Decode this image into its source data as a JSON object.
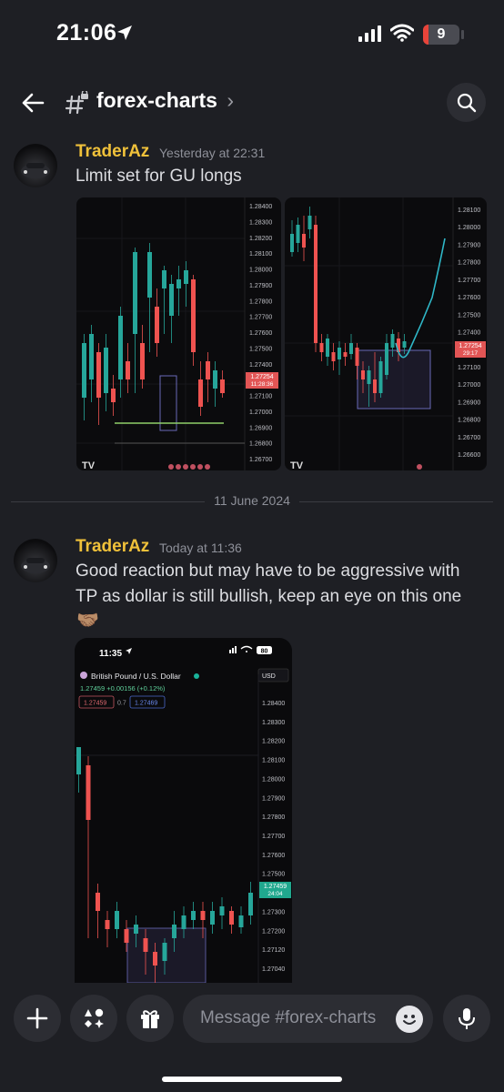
{
  "status_bar": {
    "time": "21:06",
    "battery": "9"
  },
  "header": {
    "channel": "forex-charts",
    "chevron": "›"
  },
  "messages": [
    {
      "author": "TraderAz",
      "timestamp": "Yesterday at 22:31",
      "text": "Limit set for GU longs",
      "charts": [
        {
          "prices": [
            "1.28400",
            "1.28300",
            "1.28200",
            "1.28100",
            "1.28000",
            "1.27900",
            "1.27800",
            "1.27700",
            "1.27600",
            "1.27500",
            "1.27400",
            "1.27300",
            "1.27100",
            "1.27000",
            "1.26900",
            "1.26800",
            "1.26700"
          ],
          "current_price": "1.27254",
          "current_time": "11:28:36"
        },
        {
          "prices": [
            "1.28100",
            "1.28000",
            "1.27900",
            "1.27800",
            "1.27700",
            "1.27600",
            "1.27500",
            "1.27400",
            "1.27300",
            "1.27100",
            "1.27000",
            "1.26900",
            "1.26800",
            "1.26700",
            "1.26600"
          ],
          "current_price": "1.27254",
          "current_time": "29:17"
        }
      ]
    },
    {
      "author": "TraderAz",
      "timestamp": "Today at 11:36",
      "text_lines": [
        "Good reaction but may have to be aggressive with",
        "TP as dollar is still bullish, keep an eye on this one"
      ],
      "emoji": "🤝🏽",
      "screenshot": {
        "time": "11:35",
        "battery": "80",
        "symbol": "British Pound / U.S. Dollar",
        "currency": "USD",
        "quote": "1.27459 +0.00156 (+0.12%)",
        "bid": "1.27459",
        "spread": "0.7",
        "ask": "1.27469",
        "prices": [
          "1.28400",
          "1.28300",
          "1.28200",
          "1.28100",
          "1.28000",
          "1.27900",
          "1.27800",
          "1.27700",
          "1.27600",
          "1.27500",
          "1.27400",
          "1.27300",
          "1.27200",
          "1.27120",
          "1.27040"
        ],
        "current_price": "1.27459",
        "current_time": "24:04"
      }
    }
  ],
  "date_divider": "11 June 2024",
  "composer": {
    "placeholder": "Message #forex-charts"
  }
}
